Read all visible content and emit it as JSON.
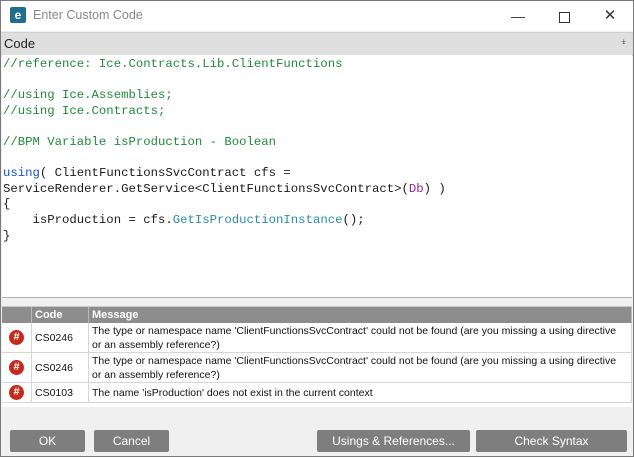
{
  "window": {
    "title": "Enter Custom Code",
    "app_icon_glyph": "e"
  },
  "panel": {
    "title": "Code",
    "pin_glyph": "📌"
  },
  "code": {
    "line1": "//reference: Ice.Contracts.Lib.ClientFunctions",
    "line3": "//using Ice.Assemblies;",
    "line4": "//using Ice.Contracts;",
    "line6": "//BPM Variable isProduction - Boolean",
    "using_kw": "using",
    "line8_rest": "( ClientFunctionsSvcContract cfs =",
    "line9_a": "ServiceRenderer.GetService<ClientFunctionsSvcContract>(",
    "line9_db": "Db",
    "line9_b": ") )",
    "open_brace": "{",
    "line11_a": "    isProduction = cfs.",
    "line11_method": "GetIsProductionInstance",
    "line11_b": "();",
    "close_brace": "}"
  },
  "errors": {
    "columns": [
      "",
      "Code",
      "Message"
    ],
    "rows": [
      {
        "code": "CS0246",
        "message": "The type or namespace name 'ClientFunctionsSvcContract' could not be found (are you missing a using directive or an assembly reference?)"
      },
      {
        "code": "CS0246",
        "message": "The type or namespace name 'ClientFunctionsSvcContract' could not be found (are you missing a using directive or an assembly reference?)"
      },
      {
        "code": "CS0103",
        "message": "The name 'isProduction' does not exist in the current context"
      }
    ]
  },
  "buttons": {
    "ok": "OK",
    "cancel": "Cancel",
    "usings": "Usings & References...",
    "check": "Check Syntax"
  },
  "colors": {
    "comment": "#218a3a",
    "keyword": "#1a4fd0",
    "type": "#9a1fa0",
    "method": "#2a8ca8",
    "error": "#c42b1c",
    "button": "#7e7e7e"
  }
}
